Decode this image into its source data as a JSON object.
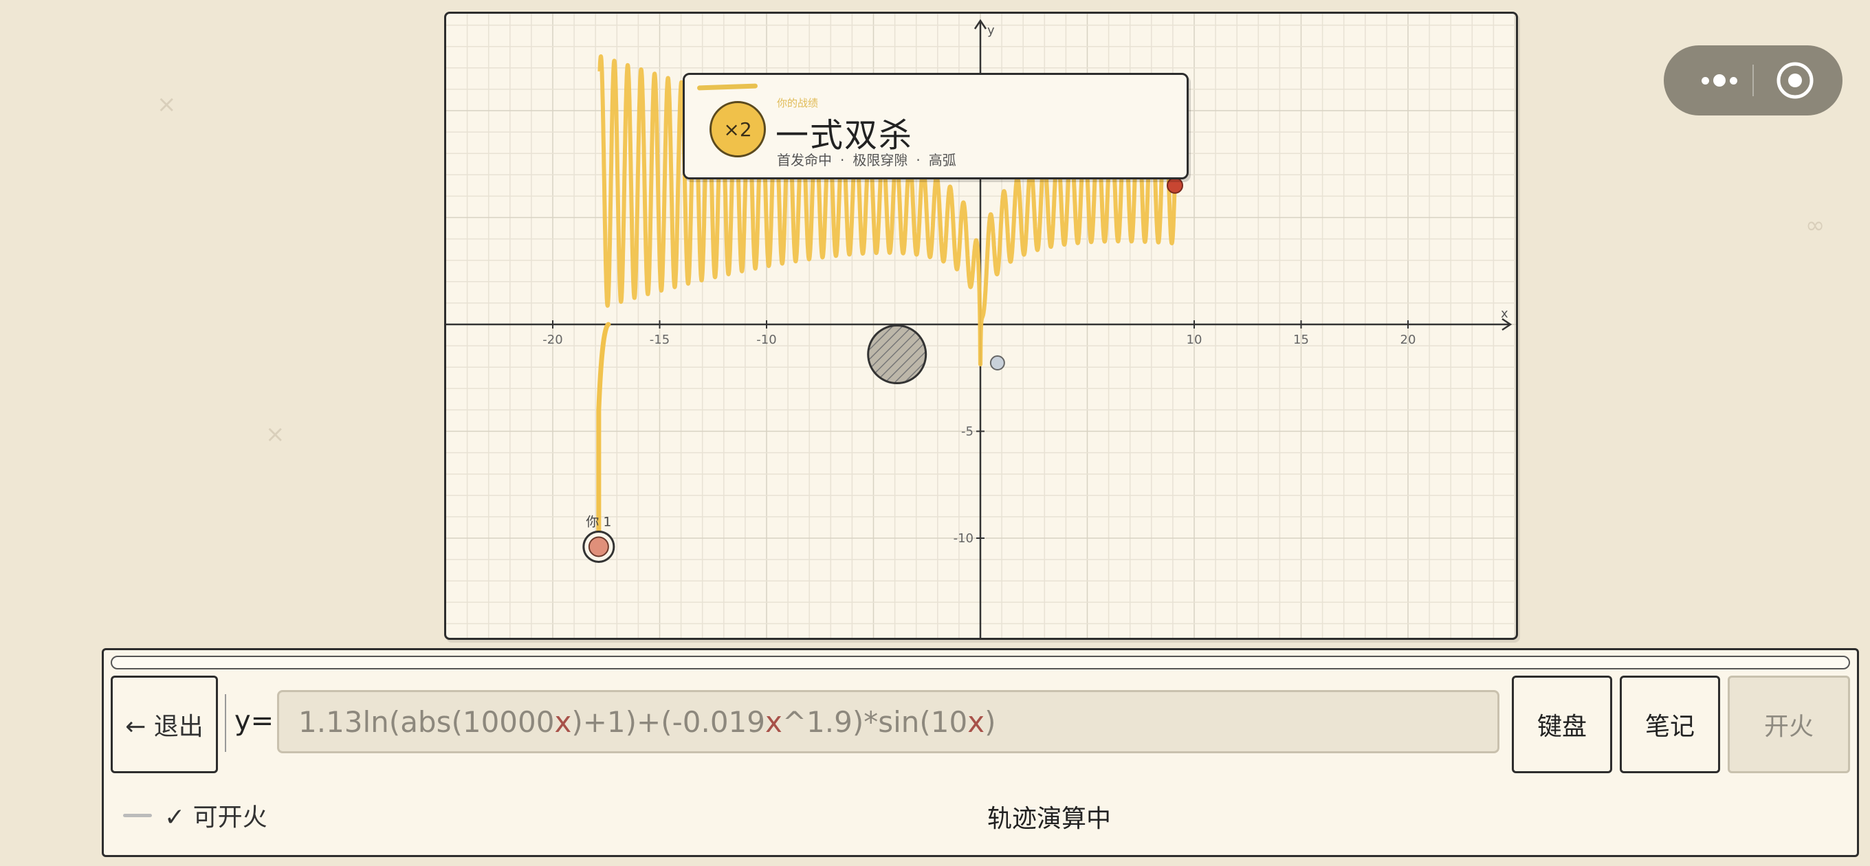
{
  "board": {
    "x_ticks": [
      "-20",
      "-15",
      "-10",
      "10",
      "15",
      "20"
    ],
    "y_ticks": [
      "-5",
      "-10"
    ],
    "x_axis_label": "x",
    "y_axis_label": "y",
    "player_label": "你 1",
    "curve_color": "#f1c24d",
    "enemy_color": "#c84632"
  },
  "card": {
    "kicker": "你的战绩",
    "medal": "×2",
    "title": "一式双杀",
    "tags": [
      "首发命中",
      "极限穿隙",
      "高弧"
    ]
  },
  "panel": {
    "exit_label": "← 退出",
    "y_prefix": "y=",
    "formula_parts": [
      "1.13ln(abs(10000",
      "x",
      ")+1)+(-0.019",
      "x",
      "^1.9)*sin(10",
      "x",
      ")"
    ],
    "keyboard_label": "键盘",
    "notes_label": "笔记",
    "fire_label": "开火",
    "status_left": "✓ 可开火",
    "status_center": "轨迹演算中"
  }
}
